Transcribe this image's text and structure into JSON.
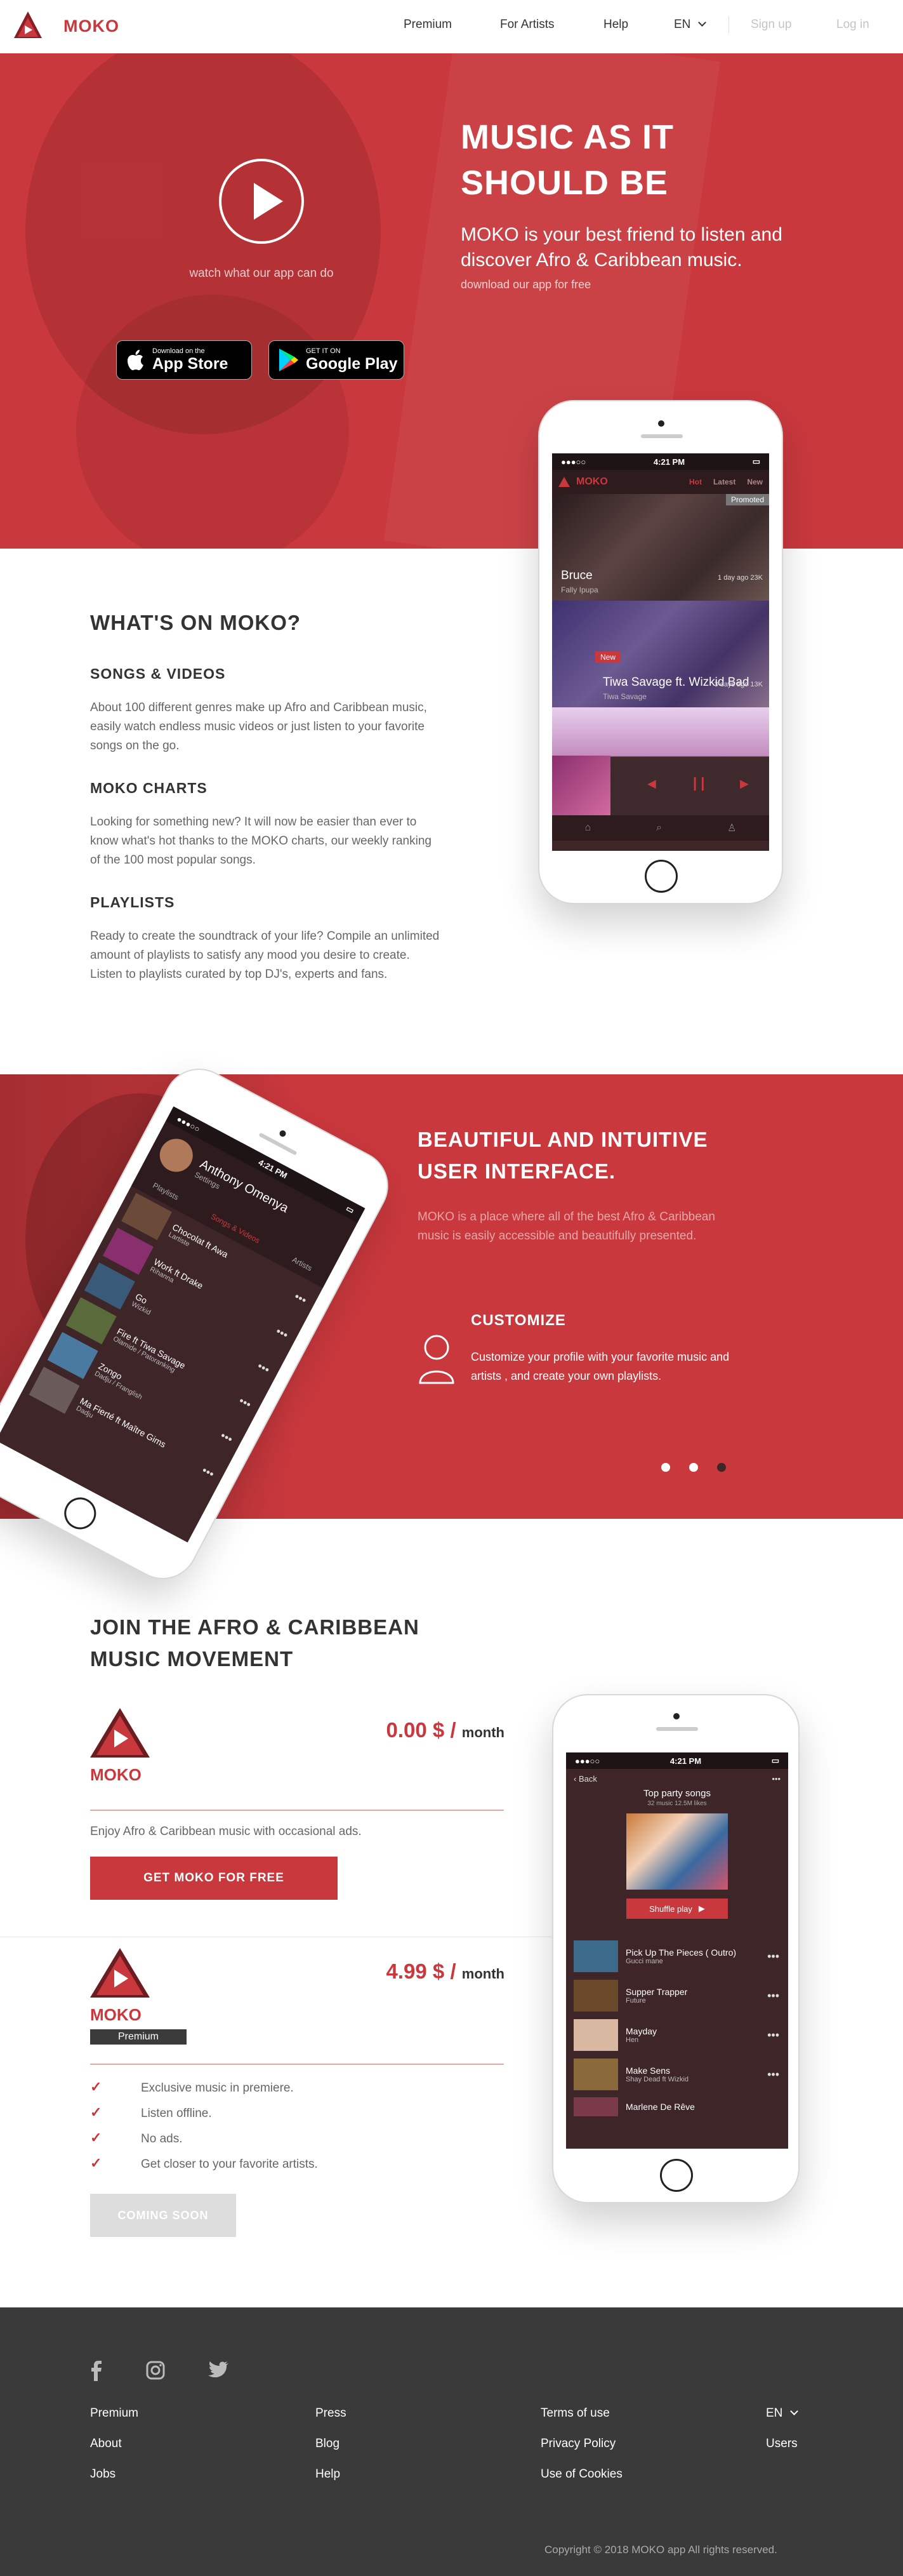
{
  "colors": {
    "brand": "#c9383d",
    "dark": "#3d2528",
    "footer": "#3a3a3a"
  },
  "header": {
    "logo_text": "MOKO",
    "nav": {
      "premium": "Premium",
      "artists": "For Artists",
      "help": "Help",
      "lang": "EN",
      "signup": "Sign up",
      "login": "Log in"
    }
  },
  "hero": {
    "title": "MUSIC AS IT SHOULD BE",
    "subtitle": "MOKO is your best friend to listen and discover Afro & Caribbean music.",
    "download_text": "download our app for free",
    "watch_text": "watch what our app can do",
    "app_store": {
      "small": "Download on the",
      "big": "App Store"
    },
    "google_play": {
      "small": "GET IT ON",
      "big": "Google Play"
    }
  },
  "hero_phone": {
    "time": "4:21 PM",
    "logo": "MOKO",
    "tabs": [
      "Hot",
      "Latest",
      "New"
    ],
    "card1": {
      "badge": "Promoted",
      "title": "Bruce",
      "artist": "Fally Ipupa",
      "meta": "1 day ago   23K"
    },
    "card2": {
      "badge": "New",
      "title": "Tiwa Savage ft. Wizkid  Bad",
      "artist": "Tiwa Savage",
      "meta": "3 days ago   13K"
    }
  },
  "what": {
    "title": "WHAT'S ON MOKO?",
    "songs_title": "SONGS & VIDEOS",
    "songs_text": "About 100 different genres make up Afro and Caribbean music, easily watch endless music videos or just listen to your favorite songs on the go.",
    "charts_title": "MOKO CHARTS",
    "charts_text": "Looking for something new? It will now be easier than ever to know what's hot thanks to the MOKO charts, our weekly ranking of the 100 most popular songs.",
    "playlists_title": "PLAYLISTS",
    "playlists_text": "Ready to create the soundtrack of your life? Compile an unlimited amount of playlists to satisfy any mood you desire to create. Listen to playlists curated by top DJ's, experts and fans."
  },
  "ui": {
    "title": "BEAUTIFUL AND INTUITIVE USER INTERFACE.",
    "text": "MOKO is a place where all of the best Afro & Caribbean music is easily accessible and beautifully presented.",
    "customize_title": "CUSTOMIZE",
    "customize_text": "Customize your profile with your favorite music and artists , and create your own playlists.",
    "phone": {
      "time": "4:21 PM",
      "profile_name": "Anthony Omenya",
      "profile_sub": "Settings",
      "tabs": [
        "Playlists",
        "Songs & Videos",
        "Artists"
      ],
      "songs": [
        {
          "t": "Chocolat ft Awa",
          "a": "Lartiste"
        },
        {
          "t": "Work ft Drake",
          "a": "Rihanna"
        },
        {
          "t": "Go",
          "a": "Wizkid"
        },
        {
          "t": "Fire ft Tiwa Savage",
          "a": "Olamide / Patoranking"
        },
        {
          "t": "Zongo",
          "a": "Dadju / Franglish"
        },
        {
          "t": "Ma Fierté ft Maître Gims",
          "a": "Dadju"
        }
      ]
    }
  },
  "join": {
    "title": "JOIN THE AFRO & CARIBBEAN MUSIC MOVEMENT",
    "free_price": "0.00 $ /",
    "per": "month",
    "free_desc": "Enjoy Afro & Caribbean music with occasional ads.",
    "free_btn": "GET MOKO FOR FREE",
    "premium_price": "4.99 $ /",
    "premium_tag": "Premium",
    "features": [
      "Exclusive music in premiere.",
      "Listen offline.",
      "No ads.",
      "Get closer to your favorite artists."
    ],
    "premium_btn": "COMING SOON",
    "logo_text": "MOKO",
    "phone": {
      "time": "4:21 PM",
      "back": "Back",
      "playlist_title": "Top party songs",
      "playlist_meta": "32 music   12.5M likes",
      "shuffle": "Shuffle play",
      "songs": [
        {
          "t": "Pick Up The Pieces ( Outro)",
          "a": "Gucci mane"
        },
        {
          "t": "Supper Trapper",
          "a": "Future"
        },
        {
          "t": "Mayday",
          "a": "Hen"
        },
        {
          "t": "Make Sens",
          "a": "Shay Dead ft Wizkid"
        },
        {
          "t": "Marlene De Rêve",
          "a": ""
        }
      ]
    }
  },
  "footer": {
    "col1": [
      "Premium",
      "About",
      "Jobs"
    ],
    "col2": [
      "Press",
      "Blog",
      "Help"
    ],
    "col3": [
      "Terms of use",
      "Privacy Policy",
      "Use of Cookies"
    ],
    "lang": "EN",
    "users": "Users",
    "copyright": "Copyright © 2018 MOKO app All rights reserved."
  }
}
